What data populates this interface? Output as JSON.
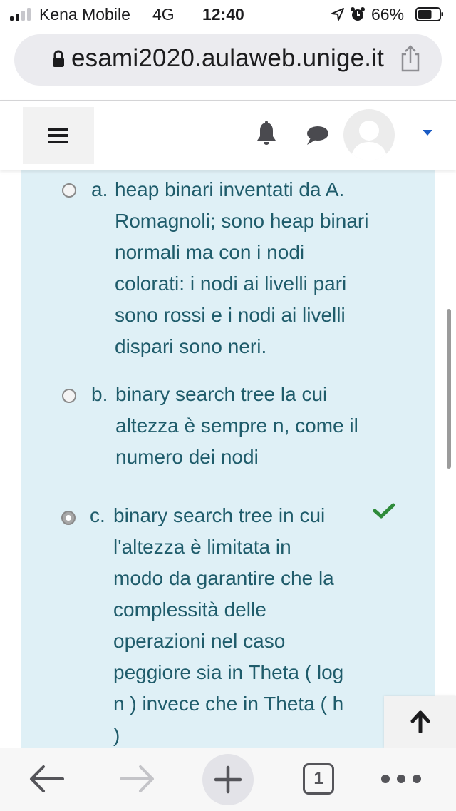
{
  "status_bar": {
    "carrier": "Kena Mobile",
    "network": "4G",
    "time": "12:40",
    "battery": "66%",
    "battery_level": 0.66,
    "signal_bars_active": 2,
    "icons": [
      "signal-icon",
      "location-arrow-icon",
      "alarm-icon",
      "battery-icon"
    ]
  },
  "browser": {
    "url": "esami2020.aulaweb.unige.it",
    "tab_count": "1",
    "icons": [
      "lock-icon",
      "share-icon",
      "back-arrow-icon",
      "forward-arrow-icon",
      "plus-icon",
      "more-dots-icon"
    ]
  },
  "navbar": {
    "icons": [
      "hamburger-menu-icon",
      "bell-icon",
      "chat-bubble-icon",
      "avatar-placeholder",
      "caret-down-icon"
    ]
  },
  "question": {
    "options": [
      {
        "letter": "a.",
        "text": "heap binari inventati da A.\nRomagnoli; sono heap binari\nnormali ma con i nodi\ncolorati: i nodi ai livelli pari\nsono rossi e i nodi ai livelli\ndispari sono neri.",
        "selected": false,
        "correct": false
      },
      {
        "letter": "b.",
        "text": "binary search tree la cui\naltezza è sempre n, come il\nnumero dei nodi",
        "selected": false,
        "correct": false
      },
      {
        "letter": "c.",
        "text": "binary search tree in cui\nl'altezza è limitata in\nmodo da garantire che la\ncomplessità delle\noperazioni nel caso\npeggiore sia in Theta ( log\nn ) invece che in Theta ( h\n)",
        "selected": true,
        "correct": true
      }
    ]
  },
  "colors": {
    "answer_background": "#dff0f6",
    "answer_text": "#1f5c6b",
    "correct_check": "#2e8b3a",
    "caret": "#1a5bc4"
  }
}
